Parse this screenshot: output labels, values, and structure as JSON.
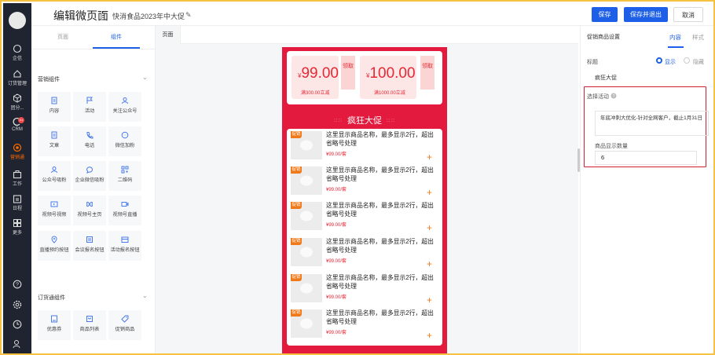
{
  "topbar": {
    "title": "编辑微页面",
    "subtitle": "快消食品2023年中大促",
    "edit_icon": "✎",
    "save": "保存",
    "save_exit": "保存并退出",
    "cancel": "取消"
  },
  "nav": [
    {
      "label": "企信",
      "icon": "chat-icon"
    },
    {
      "label": "订货管理",
      "icon": "house-icon"
    },
    {
      "label": "团分...",
      "icon": "cube-icon"
    },
    {
      "label": "CRM",
      "icon": "crm-icon",
      "badge": "01"
    },
    {
      "label": "营销通",
      "icon": "marketing-icon",
      "active": true
    },
    {
      "label": "工作",
      "icon": "briefcase-icon"
    },
    {
      "label": "日程",
      "icon": "calendar-icon"
    },
    {
      "label": "更多",
      "icon": "grid-icon"
    }
  ],
  "left": {
    "tab_page": "页面",
    "tab_component": "组件",
    "section1": "营销组件",
    "section1_items": [
      "内容",
      "活动",
      "关注公众号",
      "文章",
      "电话",
      "微信加粉",
      "公众号吸粉",
      "企业微信吸粉",
      "二维码",
      "视频号视频",
      "视频号主页",
      "视频号直播",
      "直播预约按钮",
      "会议报名按钮",
      "活动报名按钮"
    ],
    "section2": "订货通组件",
    "section2_items": [
      "优惠券",
      "商品列表",
      "促销商品"
    ]
  },
  "canvas": {
    "page_tab": "页面"
  },
  "phone": {
    "coupons": [
      {
        "price": "99.00",
        "currency": "¥",
        "desc": "满300.00立减",
        "take": "领取"
      },
      {
        "price": "100.00",
        "currency": "¥",
        "desc": "满1000.00立减",
        "take": "领取"
      }
    ],
    "promo_title": "疯狂大促",
    "deco": "::::",
    "products": [
      {
        "badge": "促销",
        "name": "这里显示商品名称，最多显示2行，超出省略号处理",
        "price": "¥99.00/套",
        "add": "+"
      },
      {
        "badge": "促销",
        "name": "这里显示商品名称，最多显示2行，超出省略号处理",
        "price": "¥99.00/套",
        "add": "+"
      },
      {
        "badge": "促销",
        "name": "这里显示商品名称，最多显示2行，超出省略号处理",
        "price": "¥99.00/套",
        "add": "+"
      },
      {
        "badge": "促销",
        "name": "这里显示商品名称，最多显示2行，超出省略号处理",
        "price": "¥99.00/套",
        "add": "+"
      },
      {
        "badge": "促销",
        "name": "这里显示商品名称，最多显示2行，超出省略号处理",
        "price": "¥99.00/套",
        "add": "+"
      },
      {
        "badge": "促销",
        "name": "这里显示商品名称，最多显示2行，超出省略号处理",
        "price": "¥99.00/套",
        "add": "+"
      }
    ]
  },
  "right": {
    "title": "促销商品设置",
    "tab_content": "内容",
    "tab_style": "样式",
    "label_title": "标题",
    "show": "显示",
    "hide": "隐藏",
    "title_value": "疯狂大促",
    "label_activity": "选择活动",
    "activity_value": "年底冲刺大优化-针对全网客户，截止1月31日",
    "label_count": "商品显示数量",
    "count_value": "6"
  },
  "colors": {
    "accent": "#1d5fe6",
    "promo": "#e3193d",
    "sidebar": "#1f2430",
    "highlight": "#d0202f"
  }
}
